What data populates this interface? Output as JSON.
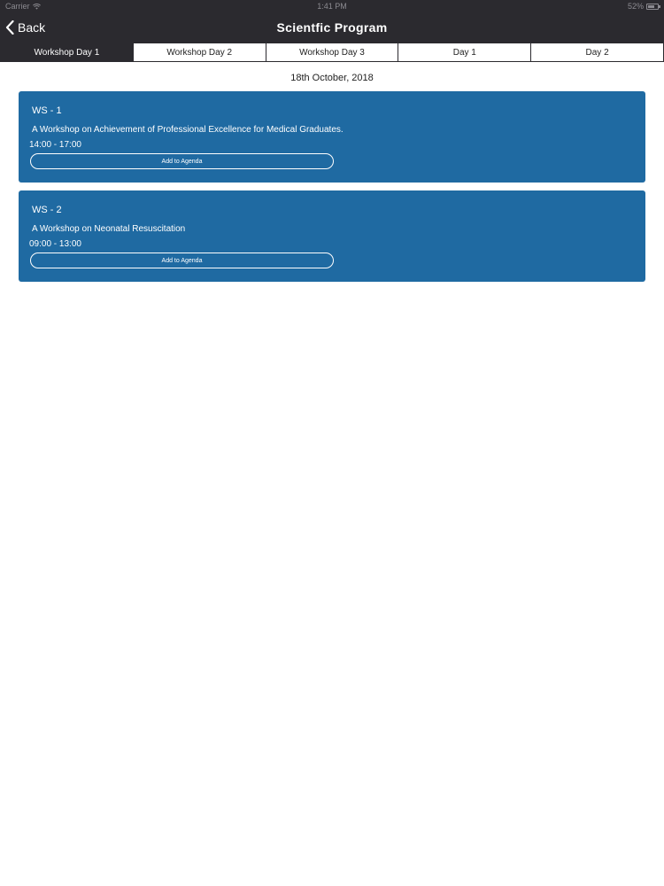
{
  "status_bar": {
    "carrier": "Carrier",
    "time": "1:41 PM",
    "battery": "52%"
  },
  "navbar": {
    "back_label": "Back",
    "title": "Scientfic Program"
  },
  "tabs": [
    {
      "label": "Workshop Day 1",
      "active": true
    },
    {
      "label": "Workshop Day 2",
      "active": false
    },
    {
      "label": "Workshop Day 3",
      "active": false
    },
    {
      "label": "Day 1",
      "active": false
    },
    {
      "label": "Day 2",
      "active": false
    }
  ],
  "date": "18th October, 2018",
  "sessions": [
    {
      "code": "WS - 1",
      "title": "A Workshop on Achievement of Professional Excellence for Medical Graduates.",
      "time": "14:00 - 17:00",
      "button_label": "Add to Agenda"
    },
    {
      "code": "WS - 2",
      "title": "A Workshop on Neonatal Resuscitation",
      "time": "09:00 - 13:00",
      "button_label": "Add to Agenda"
    }
  ],
  "colors": {
    "bar": "#2b2a2f",
    "card": "#1f6aa2"
  }
}
